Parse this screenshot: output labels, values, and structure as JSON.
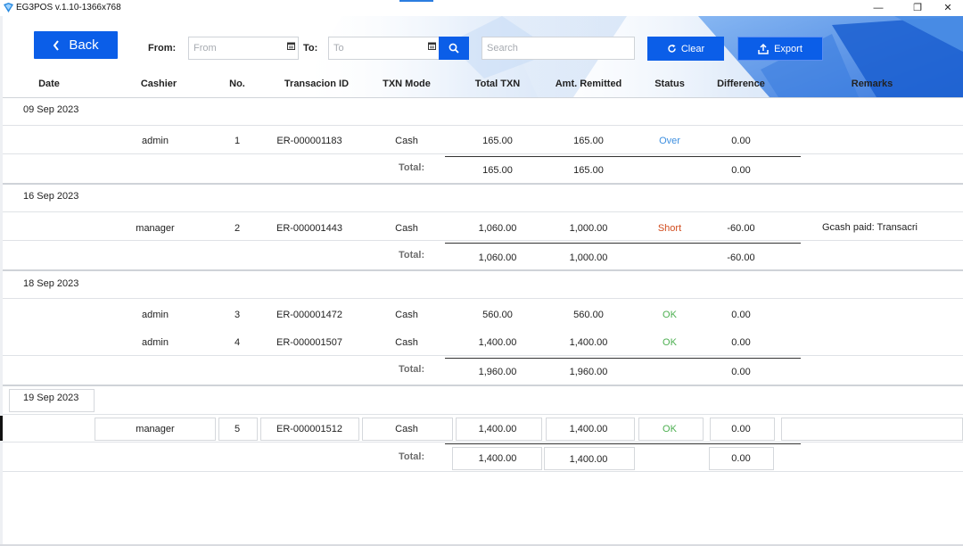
{
  "window": {
    "title": "EG3POS v.1.10-1366x768",
    "minimize": "—",
    "maximize": "❐",
    "close": "✕"
  },
  "toolbar": {
    "back_label": "Back",
    "from_label": "From:",
    "from_placeholder": "From",
    "to_label": "To:",
    "to_placeholder": "To",
    "search_placeholder": "Search",
    "clear_label": "Clear",
    "export_label": "Export"
  },
  "columns": [
    "Date",
    "Cashier",
    "No.",
    "Transacion ID",
    "TXN Mode",
    "Total TXN",
    "Amt. Remitted",
    "Status",
    "Difference",
    "Remarks"
  ],
  "colors": {
    "accent": "#0b5ee8",
    "status_over": "#3d8fe0",
    "status_short": "#d14b1d",
    "status_ok": "#4caf50"
  },
  "groups": [
    {
      "date": "09 Sep 2023",
      "rows": [
        {
          "cashier": "admin",
          "no": "1",
          "txn_id": "ER-000001183",
          "mode": "Cash",
          "total": "165.00",
          "remitted": "165.00",
          "status": "Over",
          "status_type": "over",
          "difference": "0.00",
          "remarks": ""
        }
      ],
      "total_label": "Total:",
      "total": {
        "total": "165.00",
        "remitted": "165.00",
        "difference": "0.00"
      }
    },
    {
      "date": "16 Sep 2023",
      "rows": [
        {
          "cashier": "manager",
          "no": "2",
          "txn_id": "ER-000001443",
          "mode": "Cash",
          "total": "1,060.00",
          "remitted": "1,000.00",
          "status": "Short",
          "status_type": "short",
          "difference": "-60.00",
          "remarks": "Gcash paid: Transacri"
        }
      ],
      "total_label": "Total:",
      "total": {
        "total": "1,060.00",
        "remitted": "1,000.00",
        "difference": "-60.00"
      }
    },
    {
      "date": "18 Sep 2023",
      "rows": [
        {
          "cashier": "admin",
          "no": "3",
          "txn_id": "ER-000001472",
          "mode": "Cash",
          "total": "560.00",
          "remitted": "560.00",
          "status": "OK",
          "status_type": "ok",
          "difference": "0.00",
          "remarks": ""
        },
        {
          "cashier": "admin",
          "no": "4",
          "txn_id": "ER-000001507",
          "mode": "Cash",
          "total": "1,400.00",
          "remitted": "1,400.00",
          "status": "OK",
          "status_type": "ok",
          "difference": "0.00",
          "remarks": ""
        }
      ],
      "total_label": "Total:",
      "total": {
        "total": "1,960.00",
        "remitted": "1,960.00",
        "difference": "0.00"
      }
    },
    {
      "date": "19 Sep 2023",
      "rows": [
        {
          "cashier": "manager",
          "no": "5",
          "txn_id": "ER-000001512",
          "mode": "Cash",
          "total": "1,400.00",
          "remitted": "1,400.00",
          "status": "OK",
          "status_type": "ok",
          "difference": "0.00",
          "remarks": ""
        }
      ],
      "total_label": "Total:",
      "total": {
        "total": "1,400.00",
        "remitted": "1,400.00",
        "difference": "0.00"
      }
    }
  ]
}
